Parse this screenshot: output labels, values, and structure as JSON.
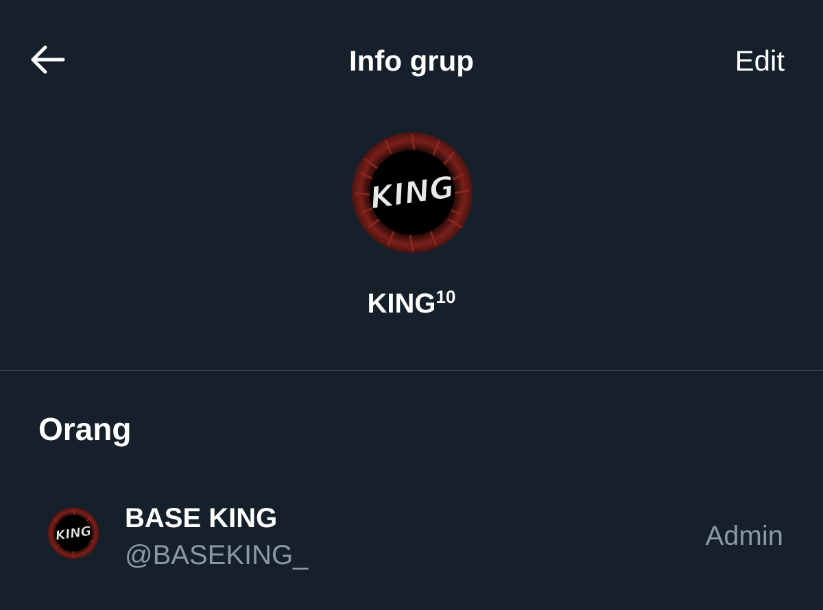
{
  "header": {
    "back_icon": "arrow-left-icon",
    "title": "Info grup",
    "edit_label": "Edit"
  },
  "group": {
    "avatar_logo_text": "KING",
    "name": "KING",
    "name_superscript": "10"
  },
  "people": {
    "title": "Orang",
    "members": [
      {
        "name": "BASE KING",
        "handle": "@BASEKING_",
        "role": "Admin",
        "avatar_logo_text": "KING"
      }
    ]
  },
  "colors": {
    "background": "#15202b",
    "divider": "#38444d",
    "text_primary": "#ffffff",
    "text_secondary": "#8b98a5",
    "avatar_red": "#7a1f1a"
  }
}
